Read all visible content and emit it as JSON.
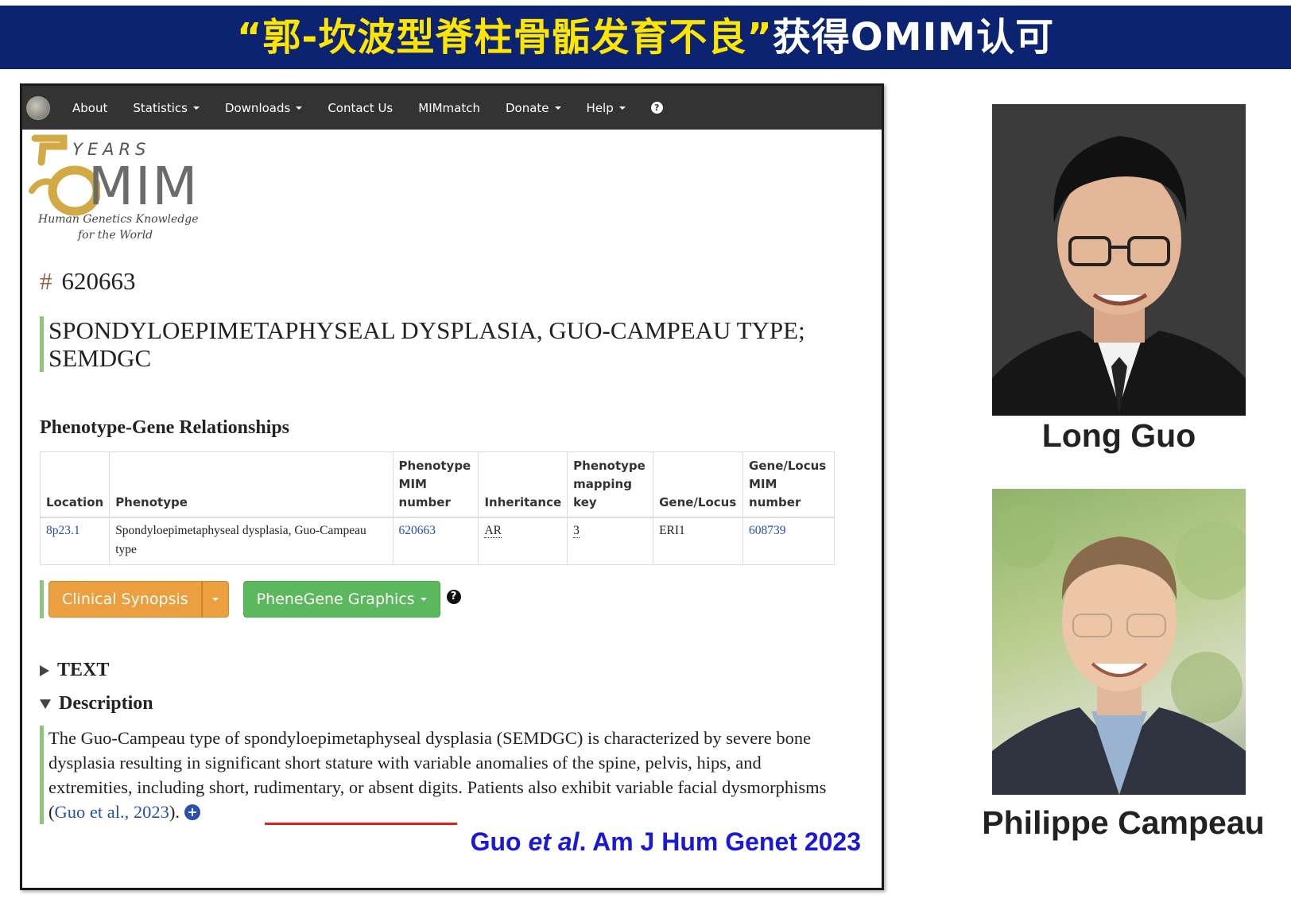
{
  "banner": {
    "title_cn": "“郭-坎波型脊柱骨骺发育不良”",
    "title_suffix": "获得OMIM认可"
  },
  "navbar": {
    "items": [
      {
        "label": "About",
        "dropdown": false
      },
      {
        "label": "Statistics",
        "dropdown": true
      },
      {
        "label": "Downloads",
        "dropdown": true
      },
      {
        "label": "Contact Us",
        "dropdown": false
      },
      {
        "label": "MIMmatch",
        "dropdown": false
      },
      {
        "label": "Donate",
        "dropdown": true
      },
      {
        "label": "Help",
        "dropdown": true
      }
    ],
    "help_icon": "question-circle-icon"
  },
  "logo": {
    "years": "YEARS",
    "mim": "MIM",
    "tagline_1": "Human Genetics Knowledge",
    "tagline_2": "for the World"
  },
  "entry": {
    "hash": "#",
    "number": "620663",
    "title": "SPONDYLOEPIMETAPHYSEAL DYSPLASIA, GUO-CAMPEAU TYPE; SEMDGC"
  },
  "phenotype_gene": {
    "heading": "Phenotype-Gene Relationships",
    "columns": [
      "Location",
      "Phenotype",
      "Phenotype MIM number",
      "Inheritance",
      "Phenotype mapping key",
      "Gene/Locus",
      "Gene/Locus MIM number"
    ],
    "rows": [
      {
        "location": "8p23.1",
        "phenotype": "Spondyloepimetaphyseal dysplasia, Guo-Campeau type",
        "phenotype_mim": "620663",
        "inheritance": "AR",
        "mapping_key": "3",
        "gene_locus": "ERI1",
        "gene_mim": "608739"
      }
    ]
  },
  "buttons": {
    "clinical_synopsis": "Clinical Synopsis",
    "phenegene": "PheneGene Graphics"
  },
  "sections": {
    "text": "TEXT",
    "description": "Description"
  },
  "description": {
    "body": "The Guo-Campeau type of spondyloepimetaphyseal dysplasia (SEMDGC) is characterized by severe bone dysplasia resulting in significant short stature with variable anomalies of the spine, pelvis, hips, and extremities, including short, rudimentary, or absent digits. Patients also exhibit variable facial dysmorphisms (",
    "ref_link": "Guo et al., 2023",
    "tail": ")."
  },
  "citation": {
    "prefix": "Guo ",
    "italic": "et al",
    "suffix": ". Am J Hum Genet 2023"
  },
  "people": [
    {
      "name": "Long Guo"
    },
    {
      "name": "Philippe Campeau"
    }
  ],
  "colors": {
    "banner_bg": "#0b2370",
    "banner_yellow": "#ffe600",
    "navbar_bg": "#333333",
    "accent_green": "#8dc67a",
    "btn_orange": "#ec9f3e",
    "btn_green": "#5cb85c",
    "link_blue": "#2a4fb0",
    "citation_blue": "#1a1ad6",
    "underline_red": "#e0201b"
  }
}
